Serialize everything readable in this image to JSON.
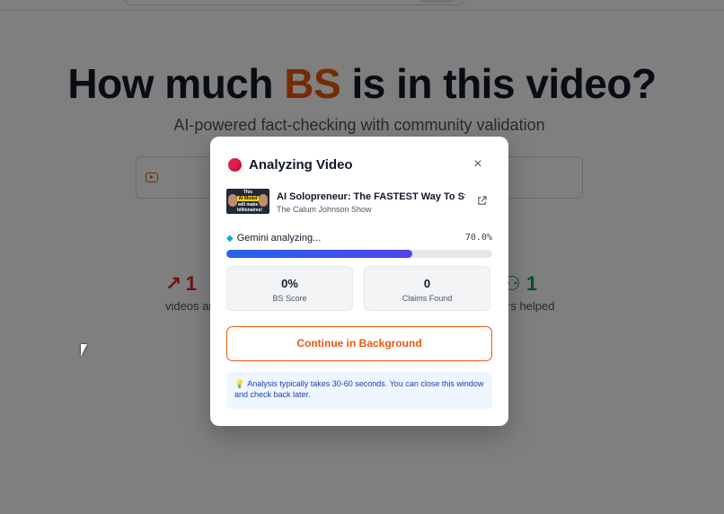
{
  "hero": {
    "title_pre": "How much ",
    "title_accent": "BS",
    "title_post": " is in this video?",
    "subtitle": "AI-powered fact-checking with community validation"
  },
  "background_stats": {
    "left_value": "1",
    "left_label": "videos an",
    "right_value": "1",
    "right_label": "rs helped"
  },
  "modal": {
    "title": "Analyzing Video",
    "close_label": "×",
    "video": {
      "title": "AI Solopreneur: The FASTEST Way To Sta...",
      "channel": "The Calum Johnson Show",
      "thumb_line1": "This",
      "thumb_line2": "AI Model",
      "thumb_line3": "will make billionaires!"
    },
    "progress": {
      "label": "Gemini analyzing...",
      "value_text": "70.0%",
      "fraction": 0.7
    },
    "stats": [
      {
        "value": "0%",
        "label": "BS Score"
      },
      {
        "value": "0",
        "label": "Claims Found"
      }
    ],
    "background_button": "Continue in Background",
    "info_text": "Analysis typically takes 30-60 seconds. You can close this window and check back later."
  },
  "colors": {
    "accent": "#ea580c",
    "progress": "#4f46e5",
    "status_dot": "#e11d48",
    "info_bg": "#eff6ff"
  },
  "icons": {
    "status": "record-dot-icon",
    "close": "close-icon",
    "external": "external-link-icon",
    "progress": "gem-icon",
    "info": "lightbulb-icon",
    "url": "youtube-icon",
    "trend": "trending-up-icon",
    "users": "users-icon"
  }
}
